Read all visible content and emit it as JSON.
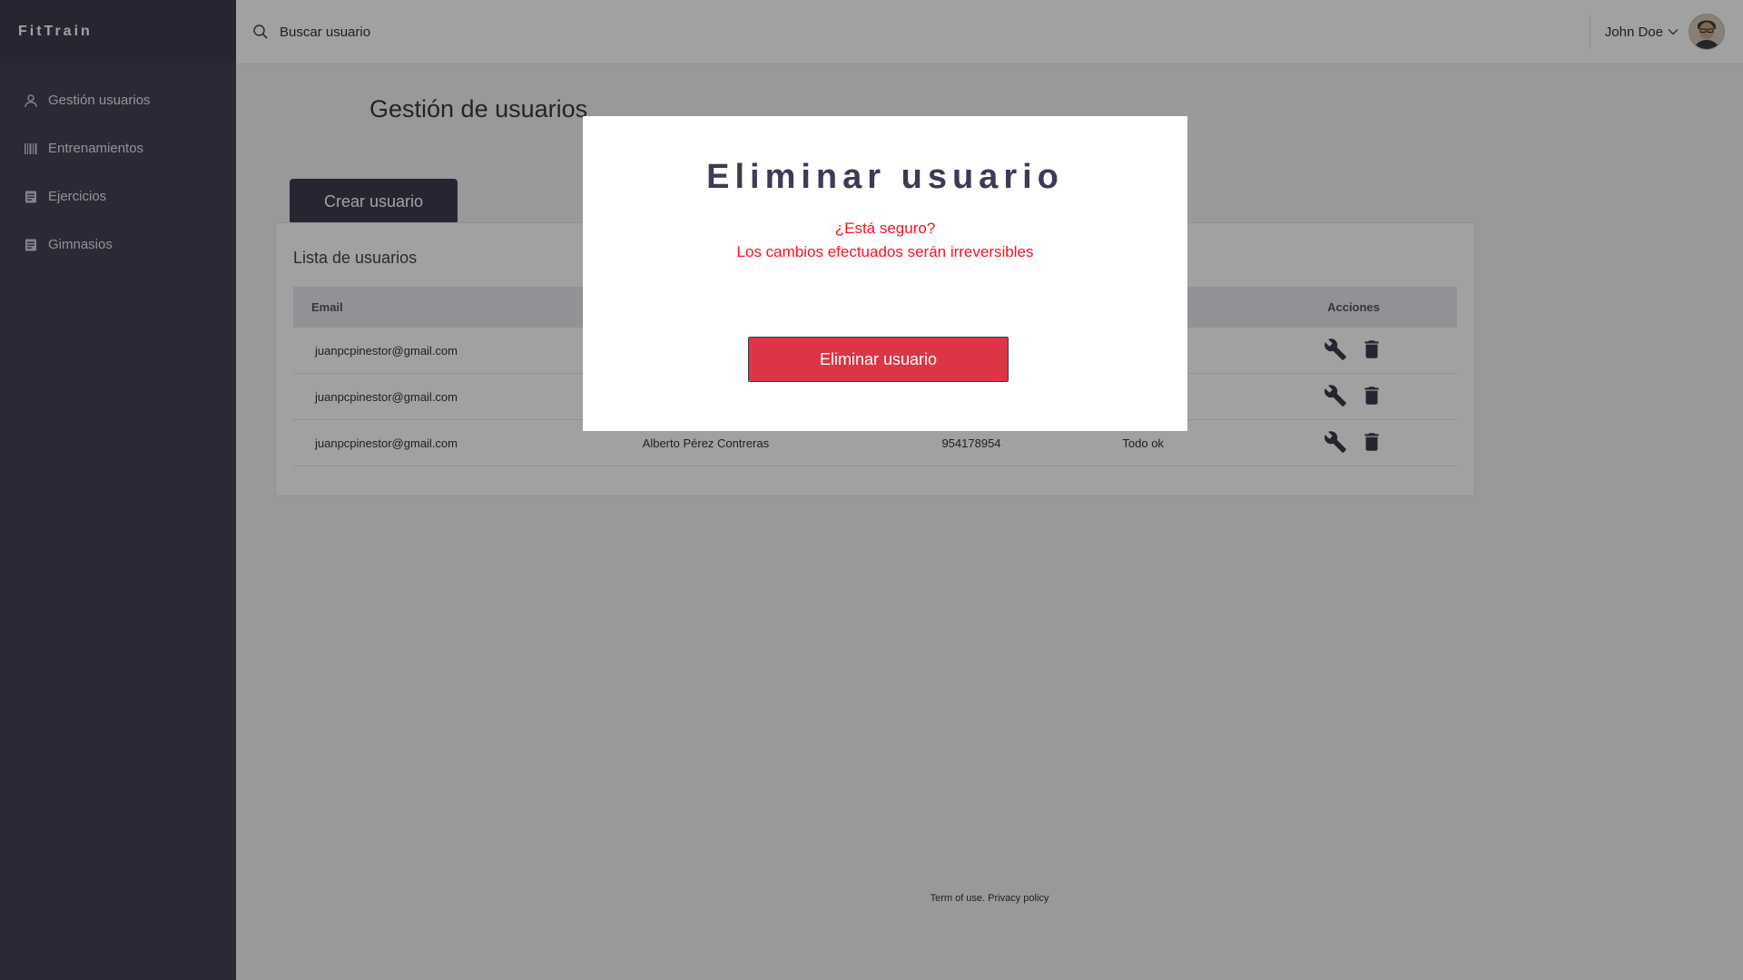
{
  "app": {
    "brand": "FitTrain"
  },
  "sidebar": {
    "items": [
      {
        "label": "Gestión usuarios",
        "icon": "user-icon"
      },
      {
        "label": "Entrenamientos",
        "icon": "barcode-icon"
      },
      {
        "label": "Ejercicios",
        "icon": "document-icon"
      },
      {
        "label": "Gimnasios",
        "icon": "document-icon"
      }
    ]
  },
  "topbar": {
    "search_placeholder": "Buscar usuario",
    "user_name": "John Doe"
  },
  "main": {
    "page_title": "Gestión de usuarios",
    "create_button": "Crear usuario",
    "list_title": "Lista de usuarios",
    "table": {
      "columns": [
        "Email",
        "",
        "",
        "",
        "Acciones"
      ],
      "rows": [
        {
          "email": "juanpcpinestor@gmail.com",
          "name": "",
          "phone": "",
          "notes": ""
        },
        {
          "email": "juanpcpinestor@gmail.com",
          "name": "",
          "phone": "",
          "notes": ""
        },
        {
          "email": "juanpcpinestor@gmail.com",
          "name": "Alberto Pérez Contreras",
          "phone": "954178954",
          "notes": "Todo ok"
        }
      ]
    }
  },
  "footer": {
    "terms": "Term of use.",
    "privacy": "Privacy policy"
  },
  "modal": {
    "title": "Eliminar usuario",
    "question": "¿Está seguro?",
    "warning": "Los cambios efectuados serán irreversibles",
    "confirm_button": "Eliminar usuario"
  },
  "colors": {
    "sidebar_bg": "#434357",
    "primary_dark": "#3d3d52",
    "danger": "#dc3545",
    "warning_text": "#ff0f1e"
  }
}
